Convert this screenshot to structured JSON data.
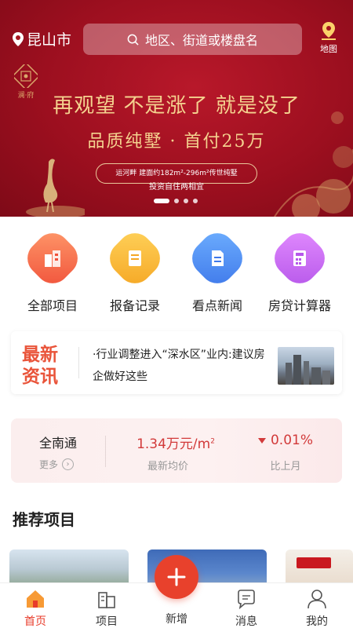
{
  "header": {
    "city": "昆山市",
    "search_placeholder": "地区、街道或楼盘名",
    "map_label": "地图"
  },
  "banner": {
    "logo_text": "澜·府",
    "headline": "再观望 不是涨了 就是没了",
    "subheadline": "品质纯墅 · 首付25万",
    "pill_text": "运河畔 建面约182m²-296m²传世纯墅",
    "pill_subtext": "投资自住两相宜",
    "slides": 4,
    "active_slide": 1
  },
  "quick_menu": [
    {
      "label": "全部项目",
      "icon": "building-icon",
      "color": "#f26b4a"
    },
    {
      "label": "报备记录",
      "icon": "book-icon",
      "color": "#f7b733"
    },
    {
      "label": "看点新闻",
      "icon": "document-icon",
      "color": "#4f8cf5"
    },
    {
      "label": "房贷计算器",
      "icon": "calculator-icon",
      "color": "#c86af0"
    }
  ],
  "news": {
    "badge_line1": "最新",
    "badge_line2": "资讯",
    "headline": "·行业调整进入“深水区”业内:建议房企做好这些"
  },
  "price": {
    "region": "全南通",
    "more_label": "更多",
    "avg_value": "1.34万元/m",
    "avg_unit_sup": "2",
    "avg_label": "最新均价",
    "change_value": "0.01%",
    "change_label": "比上月"
  },
  "recommend": {
    "title": "推荐项目"
  },
  "tabbar": {
    "home": "首页",
    "projects": "项目",
    "add": "新增",
    "messages": "消息",
    "mine": "我的"
  }
}
